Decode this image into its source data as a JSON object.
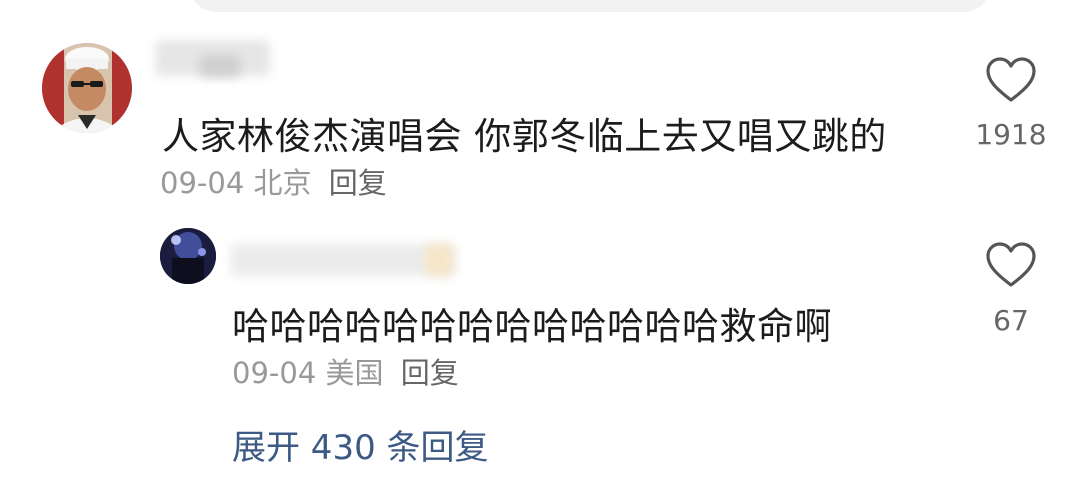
{
  "comment": {
    "text": "人家林俊杰演唱会 你郭冬临上去又唱又跳的",
    "date": "09-04",
    "location": "北京",
    "reply_label": "回复",
    "likes": "1918"
  },
  "reply": {
    "text": "哈哈哈哈哈哈哈哈哈哈哈哈哈救命啊",
    "date": "09-04",
    "location": "美国",
    "reply_label": "回复",
    "likes": "67"
  },
  "expand_replies": "展开 430 条回复",
  "icons": {
    "like": "heart-outline-icon"
  },
  "colors": {
    "link": "#3d5a85",
    "meta": "#999999",
    "text": "#1c1c1c"
  }
}
